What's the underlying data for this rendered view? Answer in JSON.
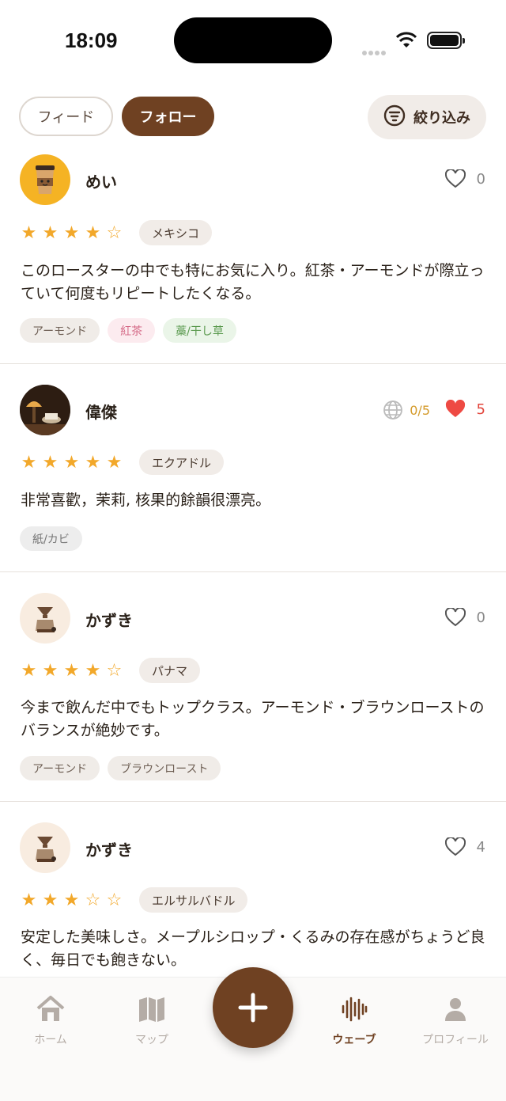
{
  "status_bar": {
    "time": "18:09"
  },
  "top_tabs": {
    "feed_label": "フィード",
    "follow_label": "フォロー",
    "filter_label": "絞り込み"
  },
  "posts": [
    {
      "username": "めい",
      "likes": "0",
      "liked": false,
      "rating": 4,
      "origin": "メキシコ",
      "comment": "このロースターの中でも特にお気に入り。紅茶・アーモンドが際立っていて何度もリピートしたくなる。",
      "tags": [
        "アーモンド",
        "紅茶",
        "藁/干し草"
      ]
    },
    {
      "username": "偉傑",
      "globe_count": "0/5",
      "likes": "5",
      "liked": true,
      "rating": 5,
      "origin": "エクアドル",
      "comment": "非常喜歡，茉莉, 核果的餘韻很漂亮。",
      "tags": [
        "紙/カビ"
      ]
    },
    {
      "username": "かずき",
      "likes": "0",
      "liked": false,
      "rating": 4,
      "origin": "パナマ",
      "comment": "今まで飲んだ中でもトップクラス。アーモンド・ブラウンローストのバランスが絶妙です。",
      "tags": [
        "アーモンド",
        "ブラウンロースト"
      ]
    },
    {
      "username": "かずき",
      "likes": "4",
      "liked": false,
      "rating": 3,
      "origin": "エルサルバドル",
      "comment": "安定した美味しさ。メープルシロップ・くるみの存在感がちょうど良く、毎日でも飽きない。",
      "tags": []
    }
  ],
  "stars": {
    "filled": "★",
    "empty": "☆"
  },
  "colors": {
    "brand": "#6f4122",
    "star": "#f2a82a",
    "like_active": "#e2453b"
  },
  "bottom_nav": {
    "home": "ホーム",
    "map": "マップ",
    "wave": "ウェーブ",
    "profile": "プロフィール",
    "active": "wave"
  }
}
